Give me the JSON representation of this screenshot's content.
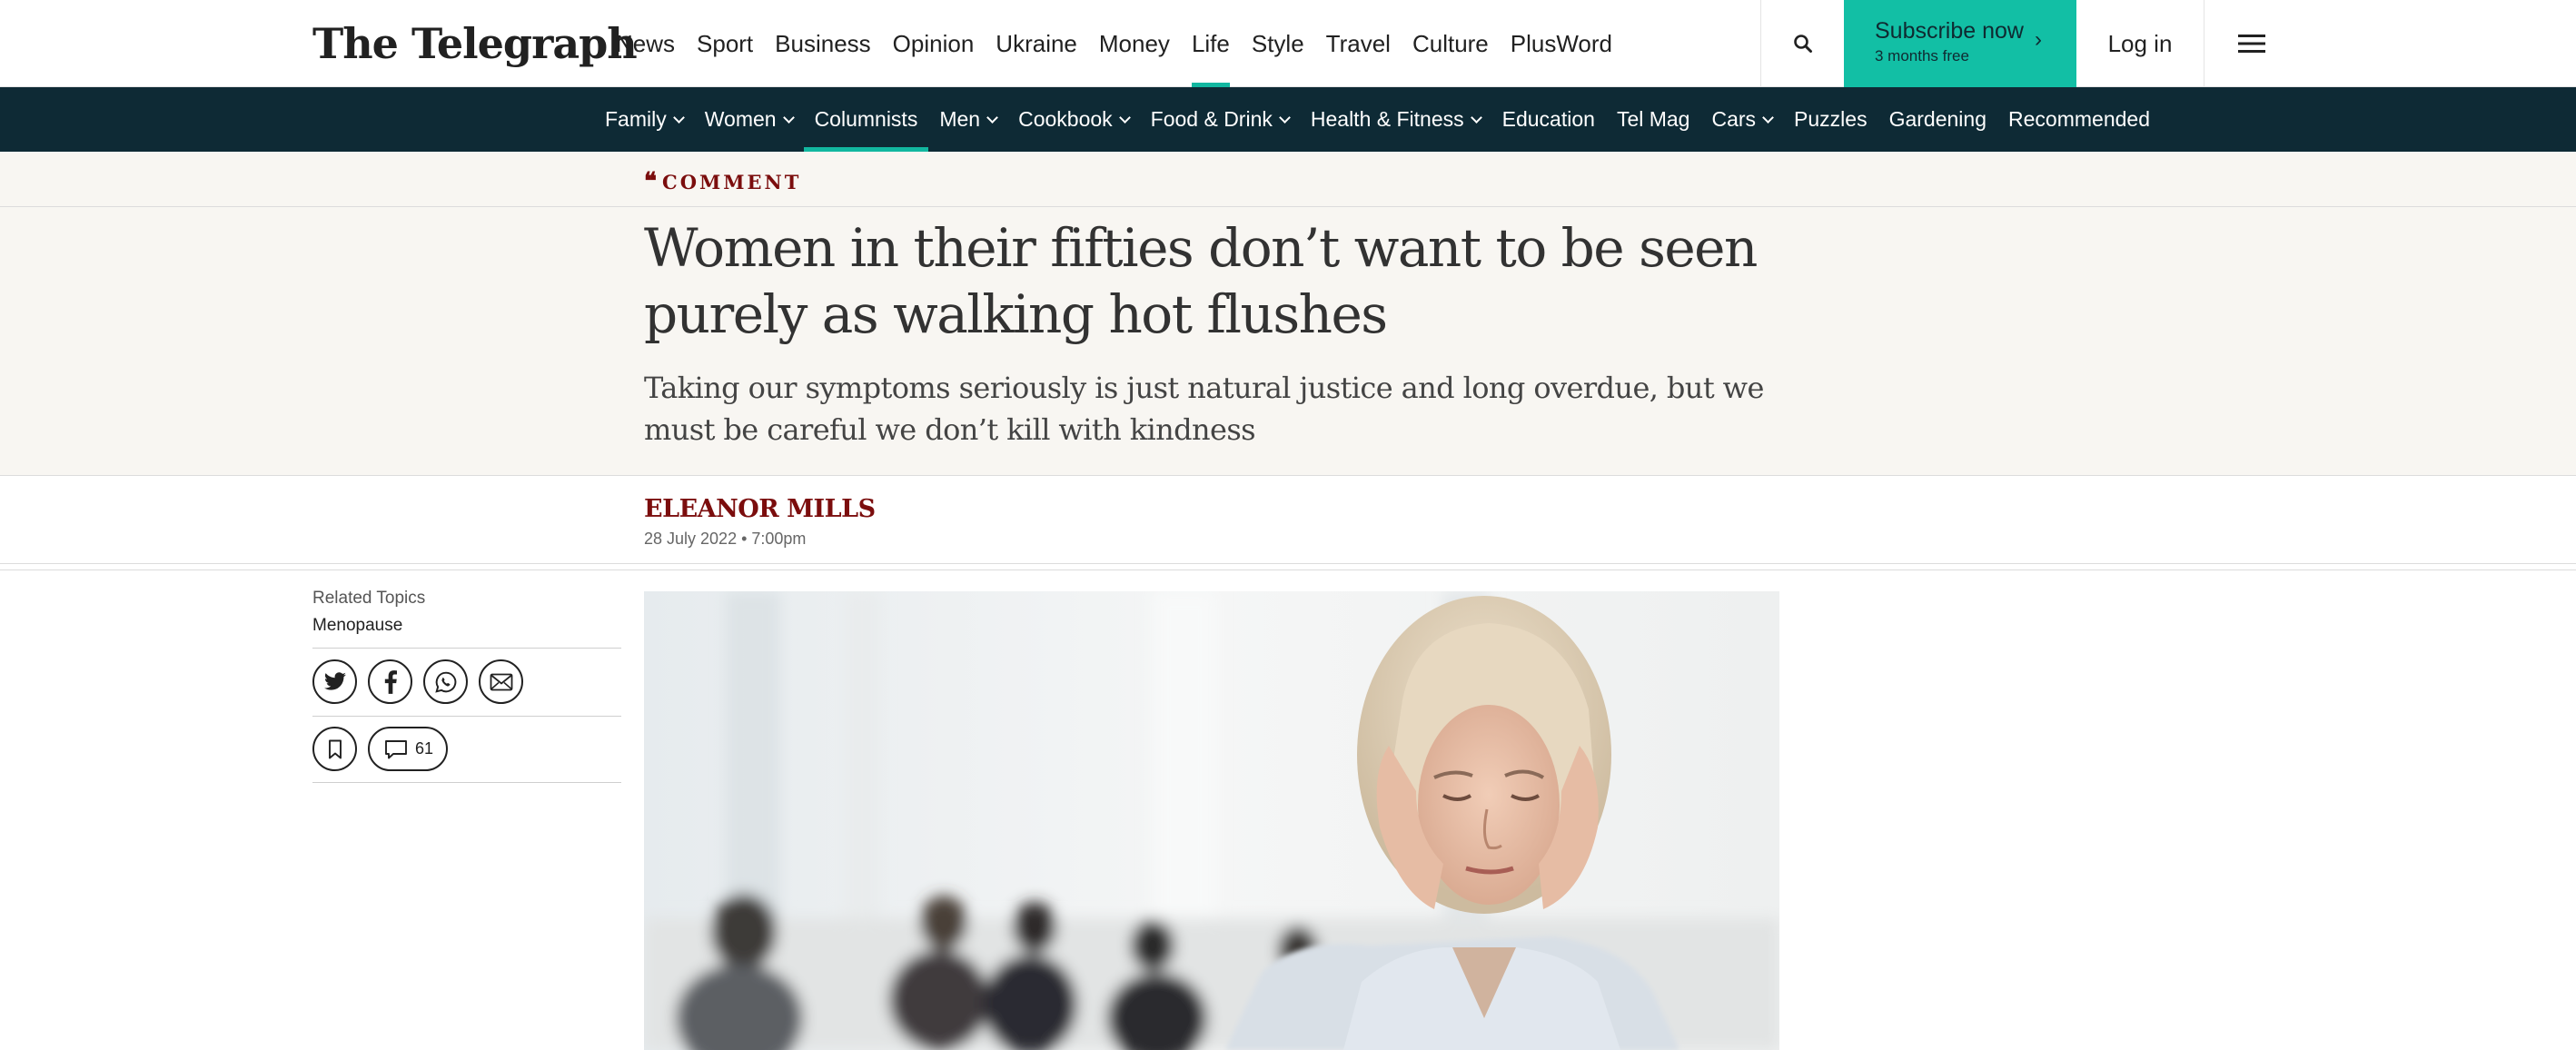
{
  "header": {
    "logo_text": "The Telegraph",
    "primary_nav": [
      "News",
      "Sport",
      "Business",
      "Opinion",
      "Ukraine",
      "Money",
      "Life",
      "Style",
      "Travel",
      "Culture",
      "PlusWord"
    ],
    "active_primary": "Life",
    "search_icon": "search-icon",
    "subscribe": {
      "label": "Subscribe now",
      "sublabel": "3 months free",
      "arrow": "›"
    },
    "login_label": "Log in",
    "menu_icon": "hamburger-menu-icon"
  },
  "subnav": {
    "items": [
      {
        "label": "Family",
        "dropdown": true
      },
      {
        "label": "Women",
        "dropdown": true
      },
      {
        "label": "Columnists",
        "dropdown": false,
        "active": true
      },
      {
        "label": "Men",
        "dropdown": true
      },
      {
        "label": "Cookbook",
        "dropdown": true
      },
      {
        "label": "Food & Drink",
        "dropdown": true
      },
      {
        "label": "Health & Fitness",
        "dropdown": true
      },
      {
        "label": "Education",
        "dropdown": false
      },
      {
        "label": "Tel Mag",
        "dropdown": false
      },
      {
        "label": "Cars",
        "dropdown": true
      },
      {
        "label": "Puzzles",
        "dropdown": false
      },
      {
        "label": "Gardening",
        "dropdown": false
      },
      {
        "label": "Recommended",
        "dropdown": false
      }
    ]
  },
  "article": {
    "section": "COMMENT",
    "headline": "Women in their fifties don’t want to be seen purely as walking hot flushes",
    "standfirst": "Taking our symptoms seriously is just natural justice and long overdue, but we must be careful we don’t kill with kindness",
    "author": "ELEANOR MILLS",
    "date": "28 July 2022 • 7:00pm"
  },
  "sidebar": {
    "related_topics_label": "Related Topics",
    "related_topics": [
      "Menopause"
    ],
    "share_icons": [
      "twitter-icon",
      "facebook-icon",
      "whatsapp-icon",
      "email-icon"
    ],
    "bookmark_icon": "bookmark-icon",
    "comment_icon": "comment-icon",
    "comment_count": "61"
  },
  "colors": {
    "accent_teal": "#12bfa5",
    "subnav_bg": "#0e2a35",
    "section_red": "#7b0d0d",
    "hero_bg": "#f8f6f2"
  }
}
